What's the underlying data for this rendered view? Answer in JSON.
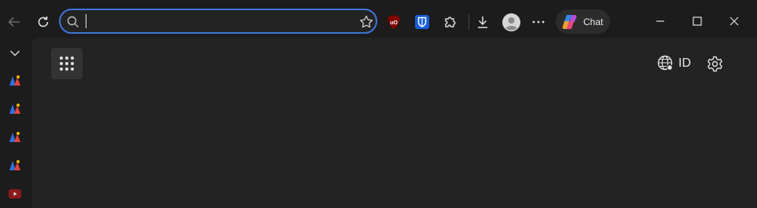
{
  "toolbar": {
    "address_value": "",
    "address_placeholder": "",
    "chat_label": "Chat"
  },
  "content": {
    "language_code": "ID"
  },
  "icons": {
    "back": "back-arrow-icon",
    "refresh": "refresh-icon",
    "search": "search-icon",
    "favorite": "star-icon",
    "ublock": "ublock-origin-icon",
    "bitwarden": "bitwarden-icon",
    "extensions": "puzzle-icon",
    "downloads": "download-icon",
    "profile": "avatar-icon",
    "more": "more-icon",
    "copilot": "copilot-icon",
    "apps": "apps-grid-icon",
    "globe": "globe-icon",
    "settings": "gear-icon"
  },
  "colors": {
    "accent": "#3f74d8",
    "ublock": "#800000",
    "bitwarden": "#175ddc",
    "background": "#1c1c1c",
    "content": "#232323"
  }
}
